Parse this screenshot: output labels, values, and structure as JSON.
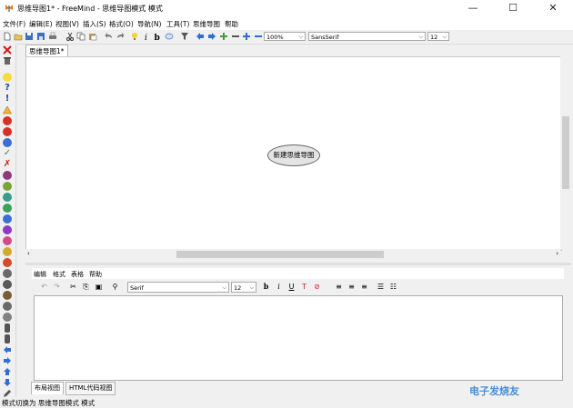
{
  "window": {
    "title": "思维导图1* - FreeMind - 思维导图模式 模式",
    "min": "—",
    "max": "☐",
    "close": "✕"
  },
  "menu": [
    "文件(F)",
    "编辑(E)",
    "视图(V)",
    "插入(S)",
    "格式(O)",
    "导航(N)",
    "工具(T)",
    "思维导图",
    "帮助"
  ],
  "toolbar": {
    "zoom": "100%",
    "font": "SansSerif",
    "size": "12"
  },
  "tab": {
    "label": "思维导图1*"
  },
  "map": {
    "root_node": "新建思维导图"
  },
  "editor": {
    "menu": [
      "编辑",
      "格式",
      "表格",
      "帮助"
    ],
    "font": "Serif",
    "size": "12",
    "tabs": [
      "布局视图",
      "HTML代码视图"
    ]
  },
  "status": "模式切换为 思维导图模式 模式",
  "watermark": "电子发烧友"
}
